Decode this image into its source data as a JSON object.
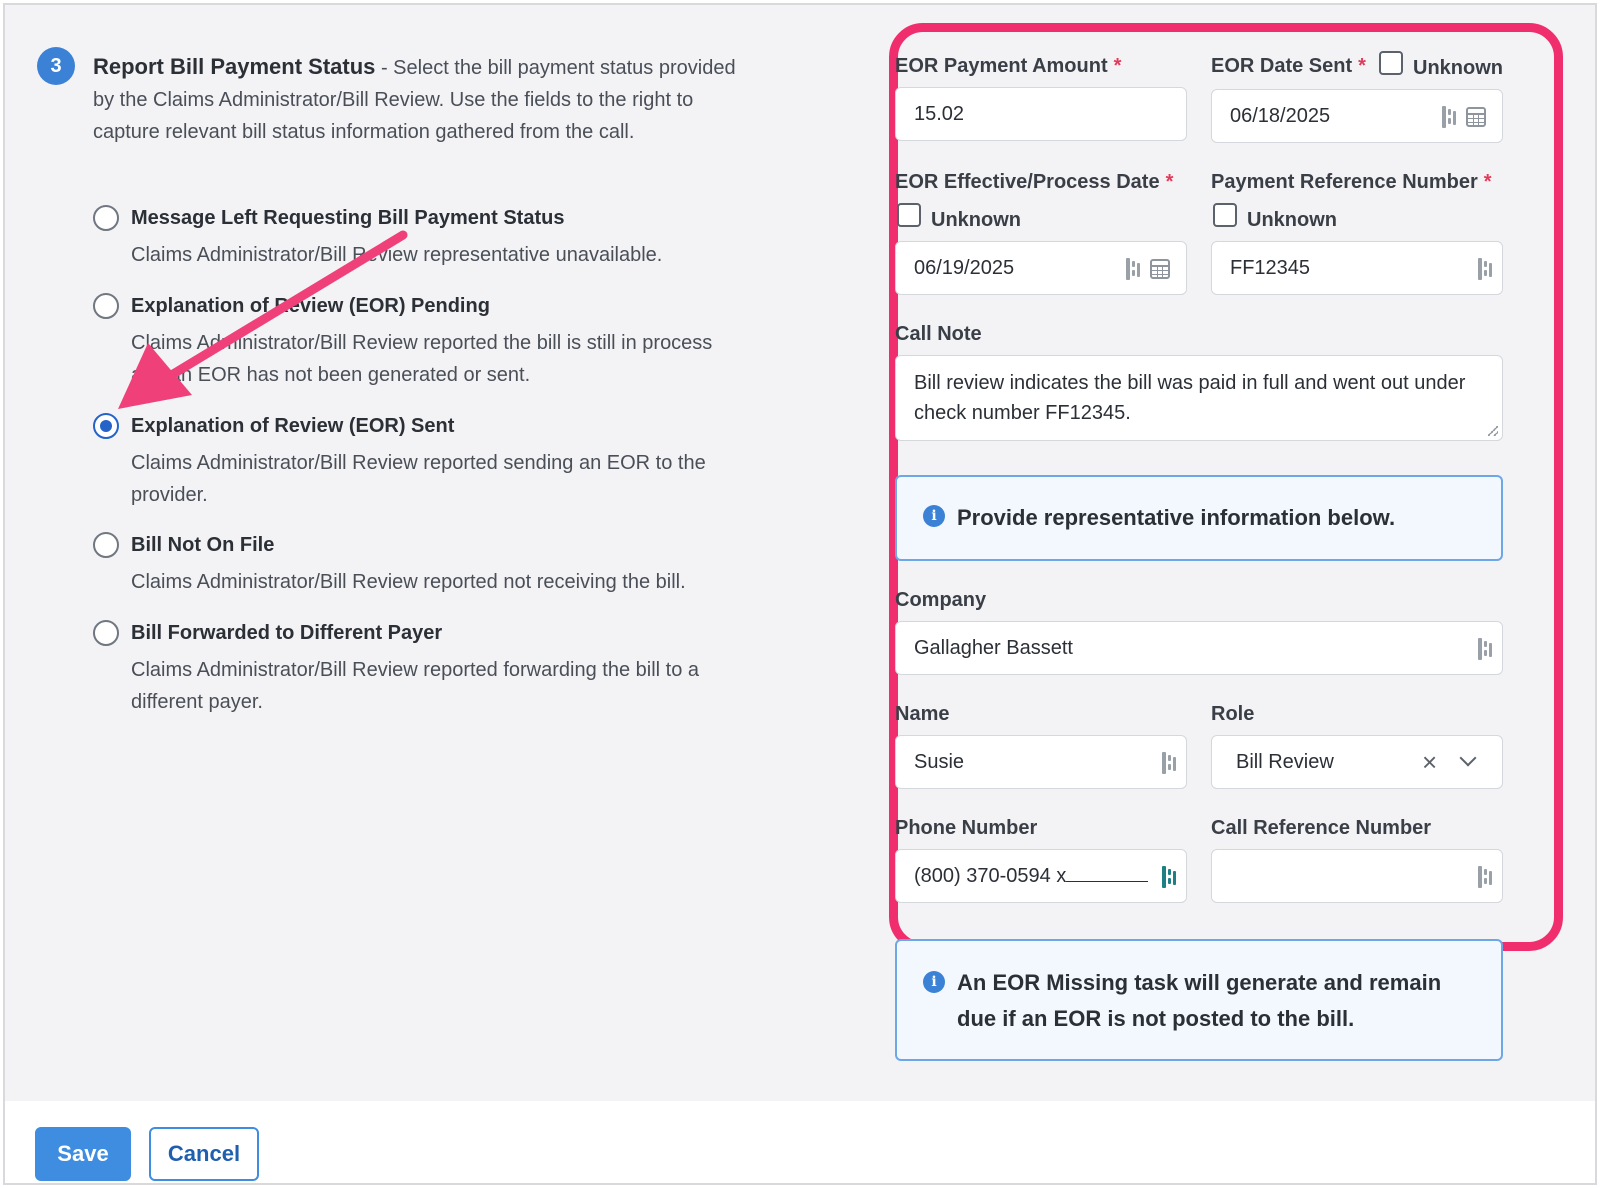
{
  "step": {
    "number": "3",
    "title": "Report Bill Payment Status",
    "description": " - Select the bill payment status provided by the Claims Administrator/Bill Review. Use the fields to the right to capture relevant bill status information gathered from the call."
  },
  "options": [
    {
      "label": "Message Left Requesting Bill Payment Status",
      "desc": "Claims Administrator/Bill Review representative unavailable.",
      "checked": false
    },
    {
      "label": "Explanation of Review (EOR) Pending",
      "desc": "Claims Administrator/Bill Review reported the bill is still in process and an EOR has not been generated or sent.",
      "checked": false
    },
    {
      "label": "Explanation of Review (EOR) Sent",
      "desc": "Claims Administrator/Bill Review reported sending an EOR to the provider.",
      "checked": true
    },
    {
      "label": "Bill Not On File",
      "desc": "Claims Administrator/Bill Review reported not receiving the bill.",
      "checked": false
    },
    {
      "label": "Bill Forwarded to Different Payer",
      "desc": "Claims Administrator/Bill Review reported forwarding the bill to a different payer.",
      "checked": false
    }
  ],
  "form": {
    "required_mark": "*",
    "eor_payment_amount": {
      "label": "EOR Payment Amount",
      "value": "15.02"
    },
    "eor_date_sent": {
      "label": "EOR Date Sent",
      "unknown_label": "Unknown",
      "value": "06/18/2025"
    },
    "eor_effective_date": {
      "label": "EOR Effective/Process Date",
      "unknown_label": "Unknown",
      "value": "06/19/2025"
    },
    "payment_reference": {
      "label": "Payment Reference Number",
      "unknown_label": "Unknown",
      "value": "FF12345"
    },
    "call_note": {
      "label": "Call Note",
      "value": "Bill review indicates the bill was paid in full and went out under check number FF12345."
    },
    "rep_info_banner": "Provide representative information below.",
    "company": {
      "label": "Company",
      "value": "Gallagher Bassett"
    },
    "name": {
      "label": "Name",
      "value": "Susie"
    },
    "role": {
      "label": "Role",
      "value": "Bill Review"
    },
    "phone": {
      "label": "Phone Number",
      "value": "(800) 370-0594 x"
    },
    "call_reference": {
      "label": "Call Reference Number",
      "value": ""
    }
  },
  "eor_missing_banner": "An EOR Missing task will generate and remain due if an EOR is not posted to the bill.",
  "footer": {
    "save_label": "Save",
    "cancel_label": "Cancel"
  },
  "colors": {
    "highlight": "#f02e6e",
    "accent": "#3b82d6",
    "arrow": "#f0407a"
  },
  "icons": [
    "info-icon",
    "calendar-icon",
    "field-tool-icon",
    "clear-x-icon",
    "chevron-down-icon",
    "annotation-arrow"
  ]
}
